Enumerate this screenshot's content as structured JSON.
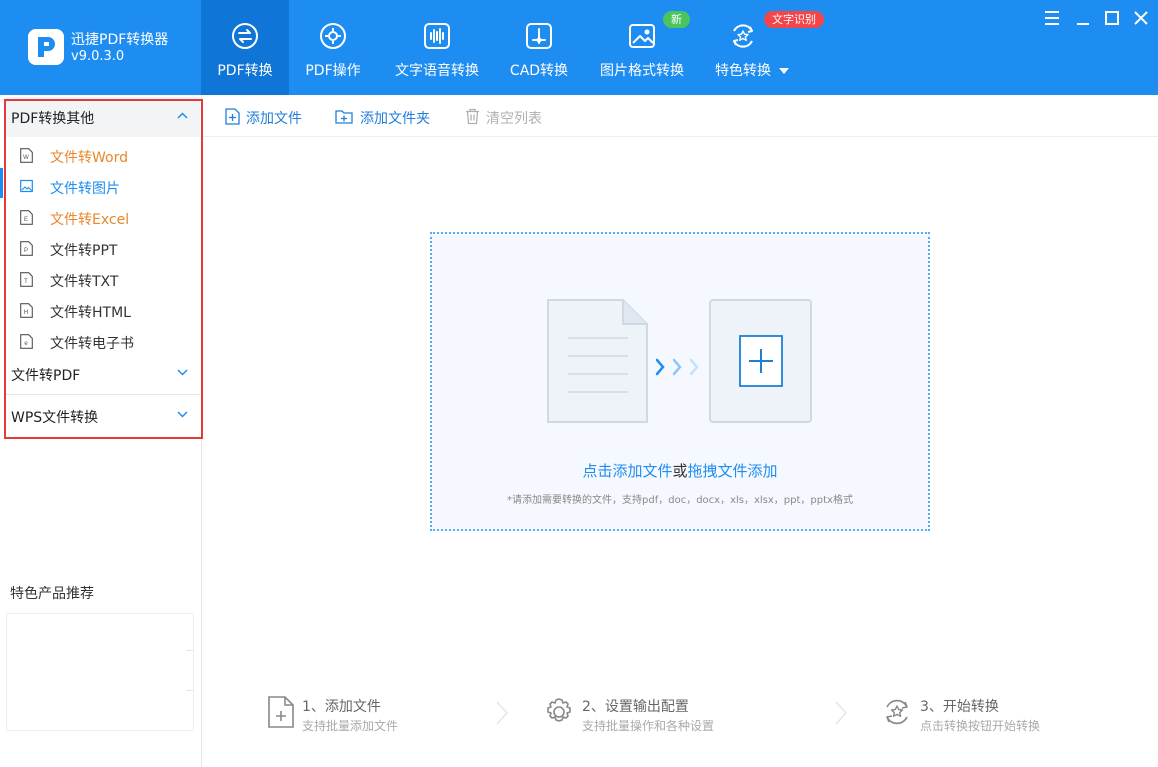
{
  "app": {
    "name": "迅捷PDF转换器",
    "version": "v9.0.3.0"
  },
  "nav": [
    {
      "label": "PDF转换",
      "icon": "convert-icon",
      "active": true
    },
    {
      "label": "PDF操作",
      "icon": "gear-circle-icon"
    },
    {
      "label": "文字语音转换",
      "icon": "audio-wave-icon"
    },
    {
      "label": "CAD转换",
      "icon": "cad-icon"
    },
    {
      "label": "图片格式转换",
      "icon": "image-icon",
      "badge": "新"
    },
    {
      "label": "特色转换",
      "icon": "star-refresh-icon",
      "badge": "文字识别",
      "dropdown": true
    }
  ],
  "sidebar": {
    "groups": [
      {
        "title": "PDF转换其他",
        "expanded": true,
        "items": [
          {
            "label": "文件转Word",
            "color": "#e8872b"
          },
          {
            "label": "文件转图片",
            "color": "#1e8df2",
            "selected": true
          },
          {
            "label": "文件转Excel",
            "color": "#e8872b"
          },
          {
            "label": "文件转PPT",
            "color": "#333333"
          },
          {
            "label": "文件转TXT",
            "color": "#333333"
          },
          {
            "label": "文件转HTML",
            "color": "#333333"
          },
          {
            "label": "文件转电子书",
            "color": "#333333"
          }
        ]
      },
      {
        "title": "文件转PDF",
        "expanded": false
      },
      {
        "title": "WPS文件转换",
        "expanded": false
      }
    ],
    "recommend_title": "特色产品推荐"
  },
  "toolbar": {
    "add_file": "添加文件",
    "add_folder": "添加文件夹",
    "clear_list": "清空列表"
  },
  "drop_zone": {
    "click_text": "点击添加文件",
    "or_text": "或",
    "drag_text": "拖拽文件添加",
    "hint": "*请添加需要转换的文件，支持pdf，doc，docx，xls，xlsx，ppt，pptx格式"
  },
  "steps": [
    {
      "title": "1、添加文件",
      "desc": "支持批量添加文件"
    },
    {
      "title": "2、设置输出配置",
      "desc": "支持批量操作和各种设置"
    },
    {
      "title": "3、开始转换",
      "desc": "点击转换按钮开始转换"
    }
  ],
  "colors": {
    "brand": "#1e8df2",
    "highlight_border": "#e23a3a"
  }
}
